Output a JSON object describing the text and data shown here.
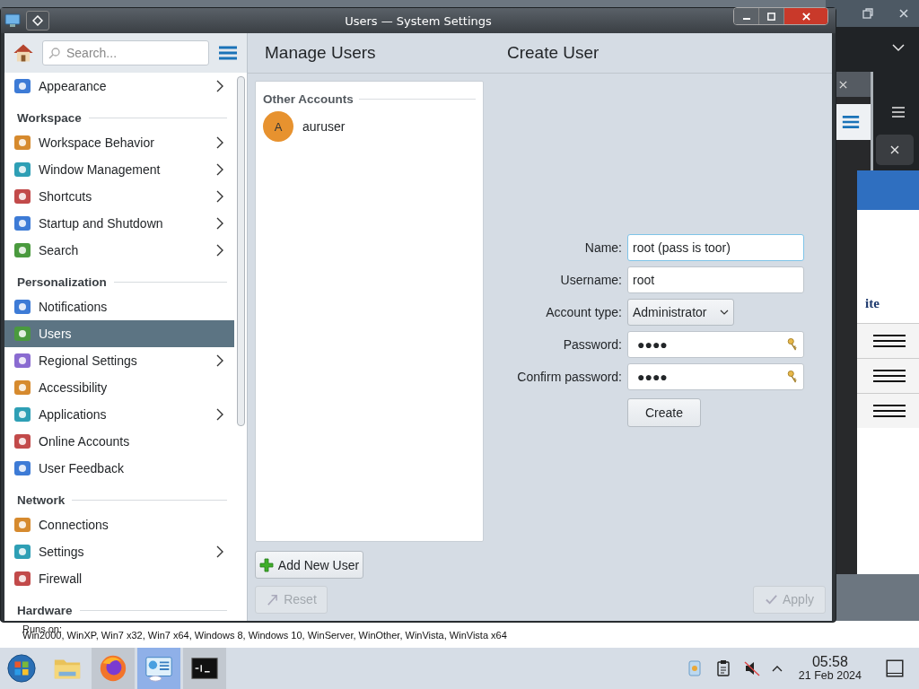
{
  "window": {
    "title": "Users — System Settings"
  },
  "sidebar": {
    "search": {
      "placeholder": "Search..."
    },
    "groups": [
      {
        "items": [
          {
            "label": "Appearance",
            "has_children": true,
            "selected": false
          }
        ]
      },
      {
        "heading": "Workspace",
        "items": [
          {
            "label": "Workspace Behavior",
            "has_children": true,
            "selected": false
          },
          {
            "label": "Window Management",
            "has_children": true,
            "selected": false
          },
          {
            "label": "Shortcuts",
            "has_children": true,
            "selected": false
          },
          {
            "label": "Startup and Shutdown",
            "has_children": true,
            "selected": false
          },
          {
            "label": "Search",
            "has_children": true,
            "selected": false
          }
        ]
      },
      {
        "heading": "Personalization",
        "items": [
          {
            "label": "Notifications",
            "has_children": false,
            "selected": false
          },
          {
            "label": "Users",
            "has_children": false,
            "selected": true
          },
          {
            "label": "Regional Settings",
            "has_children": true,
            "selected": false
          },
          {
            "label": "Accessibility",
            "has_children": false,
            "selected": false
          },
          {
            "label": "Applications",
            "has_children": true,
            "selected": false
          },
          {
            "label": "Online Accounts",
            "has_children": false,
            "selected": false
          },
          {
            "label": "User Feedback",
            "has_children": false,
            "selected": false
          }
        ]
      },
      {
        "heading": "Network",
        "items": [
          {
            "label": "Connections",
            "has_children": false,
            "selected": false
          },
          {
            "label": "Settings",
            "has_children": true,
            "selected": false
          },
          {
            "label": "Firewall",
            "has_children": false,
            "selected": false
          }
        ]
      },
      {
        "heading": "Hardware"
      }
    ]
  },
  "header": {
    "left_title": "Manage Users",
    "right_title": "Create User"
  },
  "accounts": {
    "heading": "Other Accounts",
    "users": [
      {
        "initial": "A",
        "name": "auruser"
      }
    ]
  },
  "add_button": "Add New User",
  "form": {
    "fields": [
      {
        "kind": "text",
        "label": "Name:",
        "value": "root (pass is toor)",
        "focused": true
      },
      {
        "kind": "text",
        "label": "Username:",
        "value": "root",
        "focused": false
      },
      {
        "kind": "select",
        "label": "Account type:",
        "value": "Administrator",
        "focused": false
      },
      {
        "kind": "password",
        "label": "Password:",
        "value": "●●●●",
        "focused": false
      },
      {
        "kind": "password",
        "label": "Confirm password:",
        "value": "●●●●",
        "focused": false
      }
    ],
    "submit": "Create"
  },
  "footer": {
    "buttons": [
      {
        "kind": "reset",
        "label": "Reset",
        "disabled": true
      },
      {
        "kind": "apply",
        "label": "Apply",
        "disabled": true
      }
    ]
  },
  "background": {
    "page_text": "ite",
    "runs_on_label": "Runs on:",
    "runs_on": "Win2000, WinXP, Win7 x32, Win7 x64, Windows 8, Windows 10, WinServer, WinOther, WinVista, WinVista x64"
  },
  "taskbar": {
    "apps": [
      {
        "kind": "start",
        "running": false,
        "selected": false
      },
      {
        "kind": "files",
        "running": false,
        "selected": false
      },
      {
        "kind": "browser",
        "running": true,
        "selected": false
      },
      {
        "kind": "settings",
        "running": true,
        "selected": true
      },
      {
        "kind": "terminal",
        "running": true,
        "selected": false
      }
    ],
    "clock": {
      "time": "05:58",
      "date": "21 Feb 2024"
    }
  }
}
